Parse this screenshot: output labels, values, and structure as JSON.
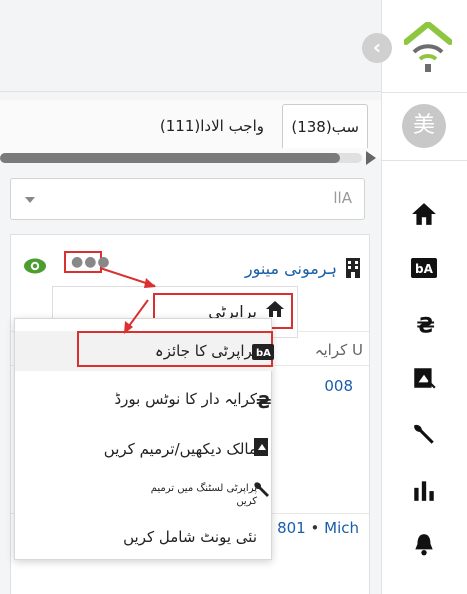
{
  "tabs": {
    "active_label": "سب(138)",
    "other_label": "واجب الادا(111)"
  },
  "filter": {
    "value": "llA"
  },
  "property": {
    "name": "ہرمونی مینور",
    "rent_column": "کرایہ U",
    "unit_number": "008",
    "bottom_row_number": "801",
    "bottom_row_dot": "•",
    "bottom_row_name": "Mich"
  },
  "submenu": {
    "label": "پراپرٹی"
  },
  "menu": {
    "items": [
      {
        "label": "پراپرٹی کا جائزہ"
      },
      {
        "label": "کرایہ دار کا نوٹس بورڈ"
      },
      {
        "label": "مالک دیکھیں/ترمیم کریں"
      },
      {
        "label": "پراپرٹی لسٹنگ میں ترمیم کریں"
      },
      {
        "label": "نئی یونٹ شامل کریں"
      }
    ]
  },
  "sidebar": {
    "avatar_text": "美",
    "collapse_glyph": "‹",
    "icons": [
      "home-icon",
      "ba-icon",
      "currency-icon",
      "document-icon",
      "wrench-icon",
      "chart-icon",
      "bell-icon"
    ]
  },
  "colors": {
    "accent_red": "#d93030",
    "link_blue": "#1a5ea8",
    "logo_green": "#8fc63f",
    "logo_gray": "#6d6d6d",
    "eye_green": "#4a9d2e"
  }
}
